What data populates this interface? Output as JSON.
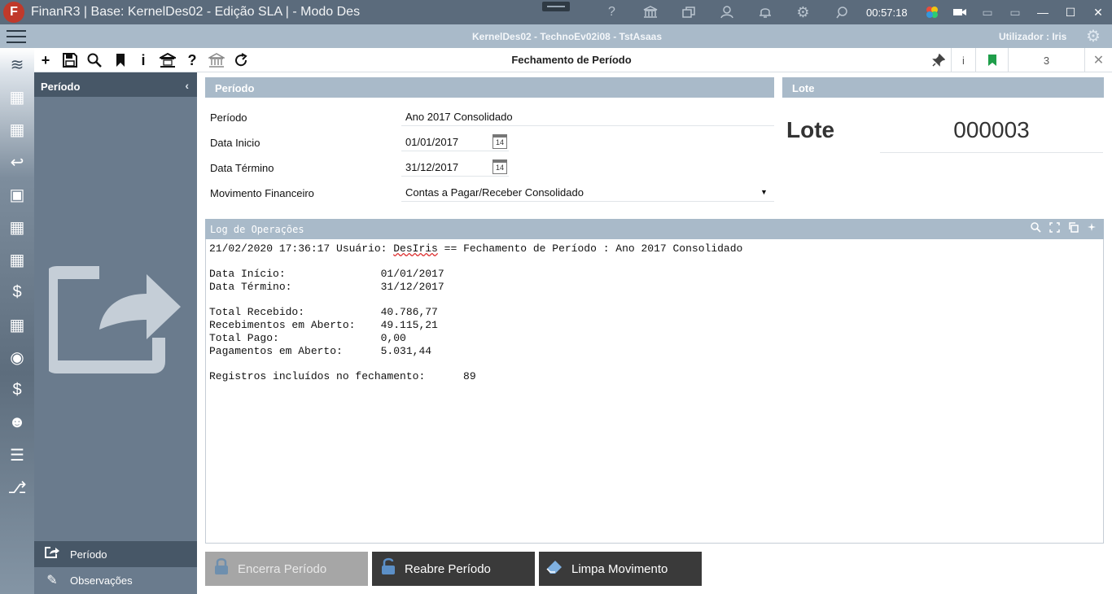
{
  "titlebar": {
    "logo": "F",
    "title": "FinanR3 | Base: KernelDes02 - Edição SLA | - Modo Des",
    "clock": "00:57:18",
    "icons": [
      "help-icon",
      "bank-icon",
      "windows-icon",
      "user-icon",
      "bell-icon",
      "gear-icon",
      "chat-icon"
    ],
    "window_icons": [
      "camera-icon",
      "monitor-small-icon",
      "monitor-icon",
      "minimize-icon",
      "maximize-icon",
      "close-icon"
    ]
  },
  "session": {
    "text": "KernelDes02 - TechnoEv02i08 - TstAsaas",
    "user": "Utilizador : Iris"
  },
  "toolbar": {
    "form_title": "Fechamento de Período",
    "info_label": "i",
    "count": "3"
  },
  "left_panel": {
    "header": "Período",
    "nav": [
      {
        "label": "Período",
        "icon": "share-icon"
      },
      {
        "label": "Observações",
        "icon": "pencil-icon"
      }
    ]
  },
  "periodo": {
    "section_title": "Período",
    "fields": [
      {
        "label": "Período",
        "value": "Ano 2017 Consolidado"
      },
      {
        "label": "Data Inicio",
        "value": "01/01/2017"
      },
      {
        "label": "Data Término",
        "value": "31/12/2017"
      },
      {
        "label": "Movimento Financeiro",
        "value": "Contas a Pagar/Receber Consolidado"
      }
    ],
    "calendar_glyph": "14"
  },
  "lote": {
    "section_title": "Lote",
    "label": "Lote",
    "value": "000003"
  },
  "log": {
    "title": "Log de Operações",
    "line1_prefix": "21/02/2020 17:36:17 Usuário: ",
    "line1_user": "DesIris",
    "line1_suffix": " == Fechamento de Período : Ano 2017 Consolidado",
    "lines_a": [
      "Data Início:               01/01/2017",
      "Data Término:              31/12/2017"
    ],
    "lines_b": [
      "Total Recebido:            40.786,77",
      "Recebimentos em Aberto:    49.115,21",
      "Total Pago:                0,00",
      "Pagamentos em Aberto:      5.031,44"
    ],
    "lines_c": [
      "Registros incluídos no fechamento:      89"
    ]
  },
  "actions": {
    "close_period": "Encerra Período",
    "reopen_period": "Reabre Período",
    "clear_movement": "Limpa Movimento"
  },
  "colors": {
    "titlebar": "#5b6b7c",
    "sessionbar": "#a9bac9",
    "panel": "#6a7b8d",
    "panel_dark": "#475767",
    "button_dark": "#3a3a3a",
    "button_disabled": "#a6a6a6",
    "bookmark_green": "#1f9e4a"
  }
}
